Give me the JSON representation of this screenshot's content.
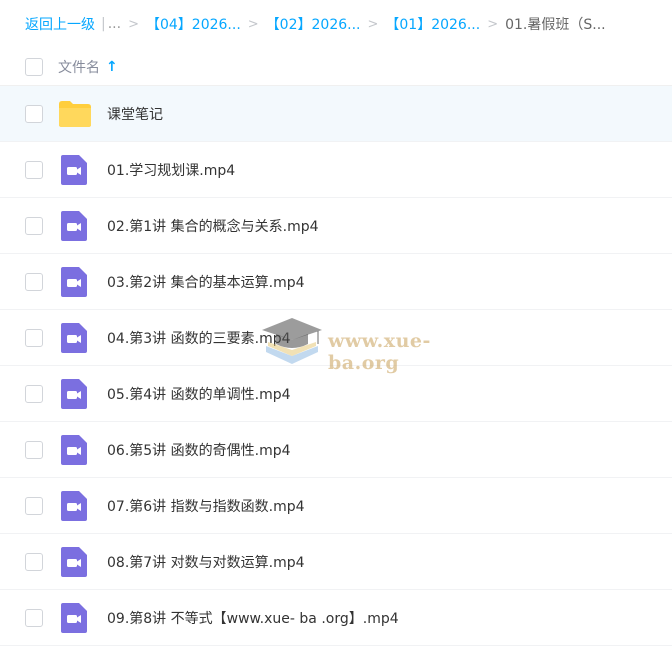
{
  "breadcrumb": {
    "back_label": "返回上一级",
    "more_label": "...",
    "items": [
      "【04】2026...",
      "【02】2026...",
      "【01】2026..."
    ],
    "current": "01.暑假班（S..."
  },
  "header": {
    "name_column": "文件名",
    "sort_icon": "arrow-up-icon"
  },
  "files": [
    {
      "name": "课堂笔记",
      "type": "folder"
    },
    {
      "name": "01.学习规划课.mp4",
      "type": "video"
    },
    {
      "name": "02.第1讲 集合的概念与关系.mp4",
      "type": "video"
    },
    {
      "name": "03.第2讲 集合的基本运算.mp4",
      "type": "video"
    },
    {
      "name": "04.第3讲 函数的三要素.mp4",
      "type": "video"
    },
    {
      "name": "05.第4讲 函数的单调性.mp4",
      "type": "video"
    },
    {
      "name": "06.第5讲 函数的奇偶性.mp4",
      "type": "video"
    },
    {
      "name": "07.第6讲 指数与指数函数.mp4",
      "type": "video"
    },
    {
      "name": "08.第7讲 对数与对数运算.mp4",
      "type": "video"
    },
    {
      "name": "09.第8讲 不等式【www.xue- ba .org】.mp4",
      "type": "video"
    }
  ],
  "watermark": {
    "text": "www.xue-ba.org"
  },
  "colors": {
    "accent": "#06a7ff",
    "folder": "#ffce3d",
    "video": "#7b6fe0",
    "selected_row": "#f3f9fd"
  }
}
